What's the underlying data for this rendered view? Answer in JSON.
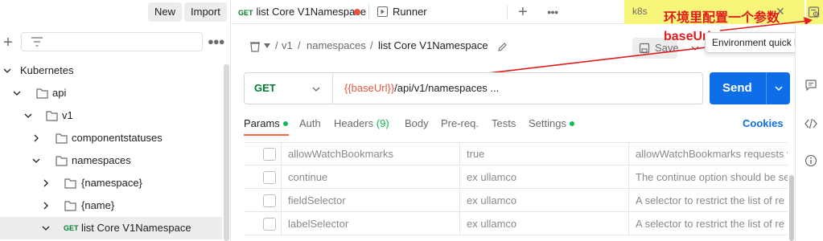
{
  "sidebar": {
    "new_label": "New",
    "import_label": "Import",
    "tree": [
      {
        "label": "Kubernetes",
        "type": "collection"
      },
      {
        "label": "api",
        "type": "folder"
      },
      {
        "label": "v1",
        "type": "folder"
      },
      {
        "label": "componentstatuses",
        "type": "folder"
      },
      {
        "label": "namespaces",
        "type": "folder"
      },
      {
        "label": "{namespace}",
        "type": "folder"
      },
      {
        "label": "{name}",
        "type": "folder"
      },
      {
        "label": "list Core V1Namespace",
        "type": "request",
        "method": "GET"
      }
    ]
  },
  "tabs": {
    "active": {
      "method": "GET",
      "label": "list Core V1Namespace"
    },
    "runner": {
      "label": "Runner"
    },
    "environment": "k8s"
  },
  "annotation": {
    "line1": "环境里配置一个参数",
    "line2": "baseUrl",
    "tooltip": "Environment quick look"
  },
  "breadcrumb": {
    "items": [
      "v1",
      "namespaces"
    ],
    "current": "list Core V1Namespace",
    "sep": "/",
    "save_label": "Save"
  },
  "request": {
    "method": "GET",
    "url_var": "{{baseUrl}}",
    "url_rest": "/api/v1/namespaces ...",
    "send_label": "Send"
  },
  "req_tabs": {
    "params": "Params",
    "auth": "Auth",
    "headers": "Headers",
    "headers_count": "(9)",
    "body": "Body",
    "prereq": "Pre-req.",
    "tests": "Tests",
    "settings": "Settings",
    "cookies": "Cookies"
  },
  "params": [
    {
      "key": "allowWatchBookmarks",
      "value": "true",
      "desc": "allowWatchBookmarks requests w"
    },
    {
      "key": "continue",
      "value": "ex ullamco",
      "desc": "The continue option should be se"
    },
    {
      "key": "fieldSelector",
      "value": "ex ullamco",
      "desc": "A selector to restrict the list of re"
    },
    {
      "key": "labelSelector",
      "value": "ex ullamco",
      "desc": "A selector to restrict the list of re"
    }
  ],
  "colors": {
    "accent": "#0d6ee8",
    "get": "#007f31",
    "annotation": "#e21b1b",
    "highlight": "#f7f57a"
  }
}
